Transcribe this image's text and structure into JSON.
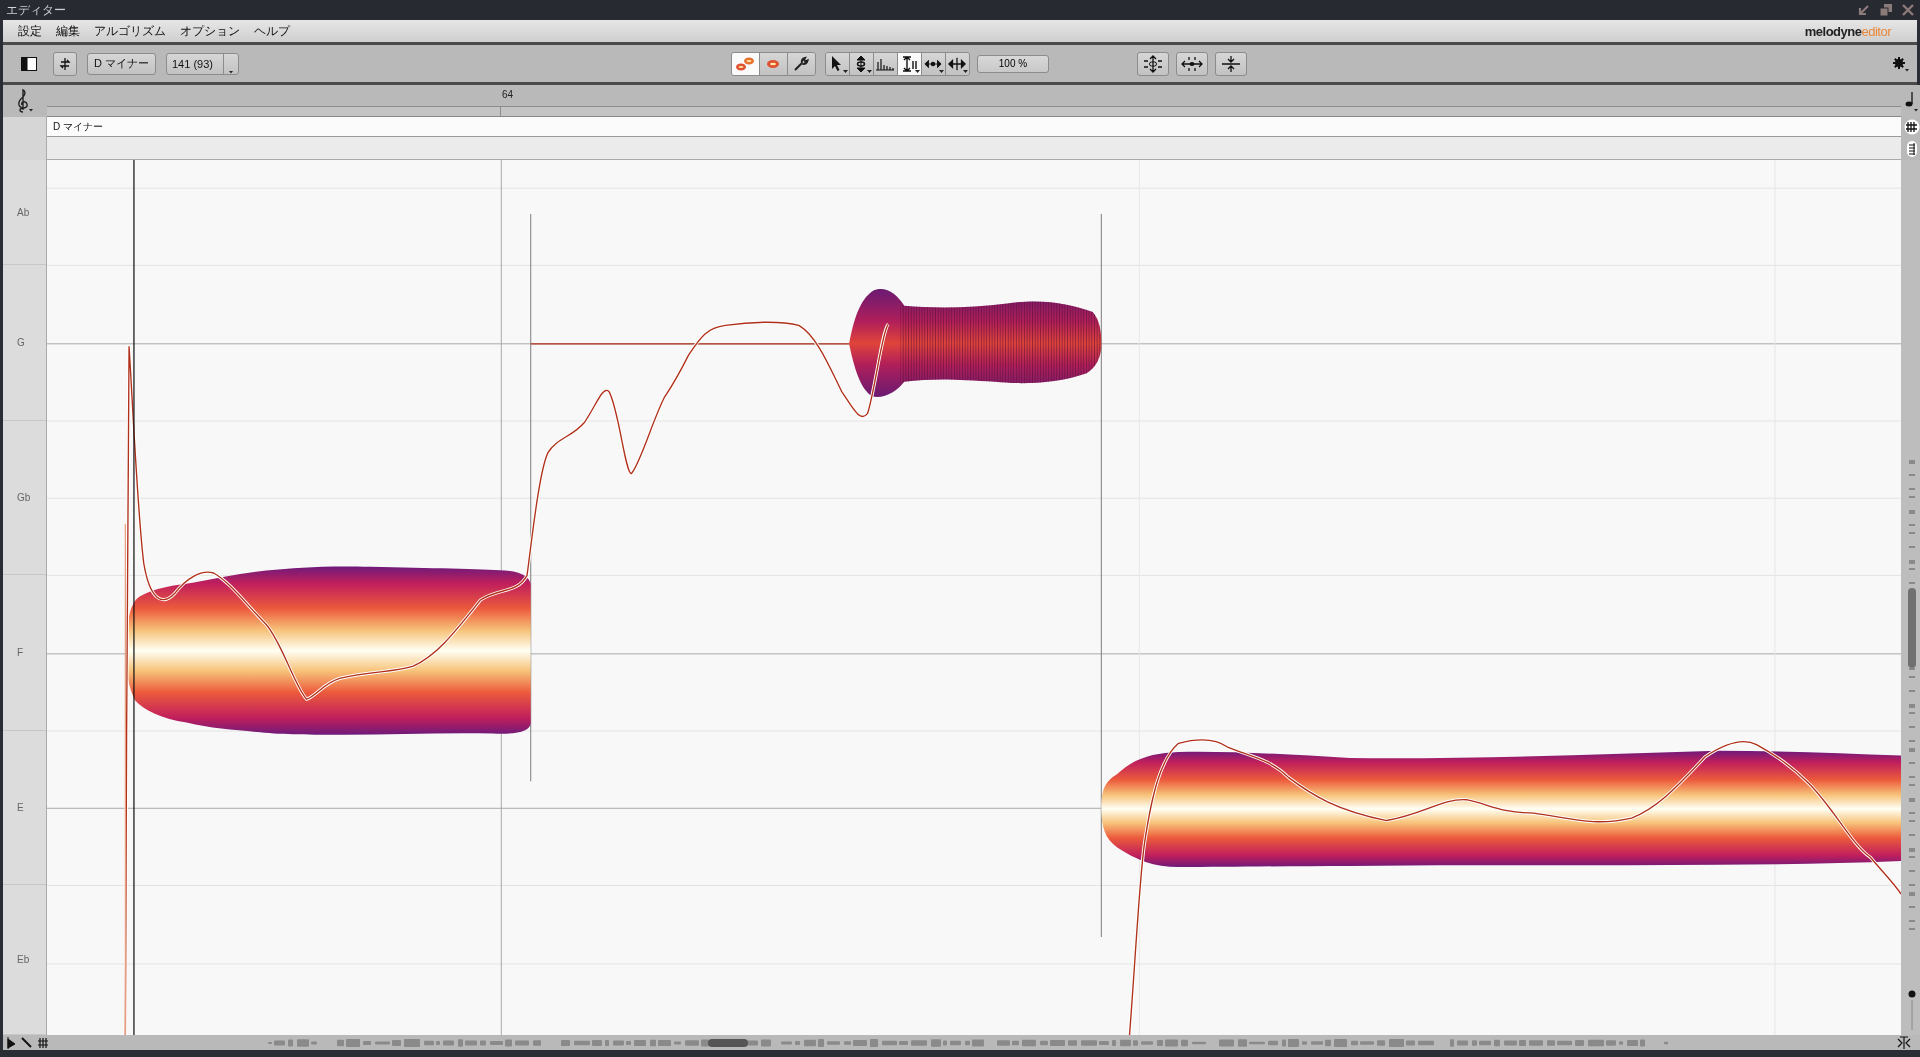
{
  "window": {
    "title": "エディター"
  },
  "menu": [
    "設定",
    "編集",
    "アルゴリズム",
    "オプション",
    "ヘルプ"
  ],
  "brand": {
    "name": "melodyne",
    "edition": "editor"
  },
  "toolbar": {
    "scale_button": "D マイナー",
    "tempo_dropdown": "141 (93)",
    "modes": [
      {
        "kind": "notes",
        "selected": true
      },
      {
        "kind": "blob",
        "selected": false
      },
      {
        "kind": "wrench",
        "selected": false
      }
    ],
    "tools": [
      {
        "kind": "pointer",
        "dropdown": true,
        "selected": false
      },
      {
        "kind": "pitch",
        "dropdown": true,
        "selected": false
      },
      {
        "kind": "amplitude",
        "dropdown": false,
        "selected": false
      },
      {
        "kind": "formant",
        "dropdown": true,
        "selected": true
      },
      {
        "kind": "time",
        "dropdown": true,
        "selected": false
      },
      {
        "kind": "move",
        "dropdown": true,
        "selected": false
      }
    ],
    "zoom": "100 %",
    "macros": [
      {
        "kind": "pitch-center"
      },
      {
        "kind": "time-center"
      },
      {
        "kind": "compress"
      }
    ]
  },
  "ruler": {
    "bar_label": "64"
  },
  "scale_header": "D マイナー",
  "pitch_labels": [
    "Ab",
    "G",
    "Gb",
    "F",
    "E",
    "Eb"
  ]
}
